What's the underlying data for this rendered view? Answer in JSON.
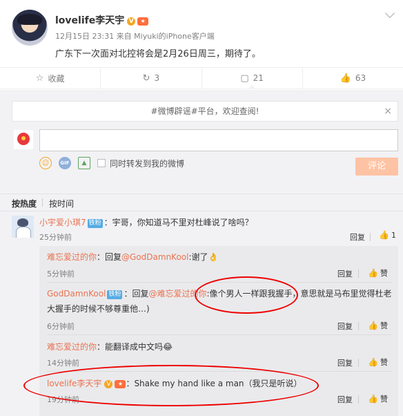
{
  "post": {
    "author": "lovelife李天宇",
    "verified_badge": "V",
    "level_badge": "★",
    "meta": "12月15日 23:31 来自 Miyuki的iPhone客户端",
    "text": "广东下一次面对北控将会是2月26日周三，期待了。"
  },
  "actions": {
    "collect": "收藏",
    "repost_count": "3",
    "comment_count": "21",
    "like_count": "63"
  },
  "icons": {
    "collect": "☆",
    "repost": "↻",
    "comment": "▢",
    "like": "👍"
  },
  "notice": {
    "text": "#微博辟谣#平台，欢迎查阅!",
    "close": "×"
  },
  "composer": {
    "repost_label": "同时转发到我的微博",
    "submit_label": "评论"
  },
  "sort": {
    "hot": "按热度",
    "time": "按时间"
  },
  "main_comment": {
    "user": "小宇爱小琪7",
    "badge": "铁粉",
    "text": "：宇哥，你知道马不里对杜峰说了啥吗？",
    "time": "25分钟前",
    "reply": "回复",
    "likes": "1"
  },
  "replies": [
    {
      "user": "难忘爱过的你",
      "prefix": "：回复",
      "mention": "@GodDamnKool",
      "text": ":谢了",
      "emoji": "👌",
      "time": "5分钟前",
      "reply": "回复",
      "like": "赞"
    },
    {
      "user": "GodDamnKool",
      "badge": "铁粉",
      "prefix": "：回复",
      "mention": "@难忘爱过的你",
      "text": ":像个男人一样跟我握手，意思就是马布里觉得杜老",
      "text2": "大握手的时候不够尊重他…)",
      "time": "6分钟前",
      "reply": "回复",
      "like": "赞"
    },
    {
      "user": "难忘爱过的你",
      "text": "：能翻译成中文吗",
      "emoji": "😂",
      "time": "14分钟前",
      "reply": "回复",
      "like": "赞"
    },
    {
      "user": "lovelife李天宇",
      "verified_badge": "V",
      "level_badge": "★",
      "text": "：Shake my hand like a man（我只是听说）",
      "time": "19分钟前",
      "reply": "回复",
      "like": "赞"
    }
  ]
}
